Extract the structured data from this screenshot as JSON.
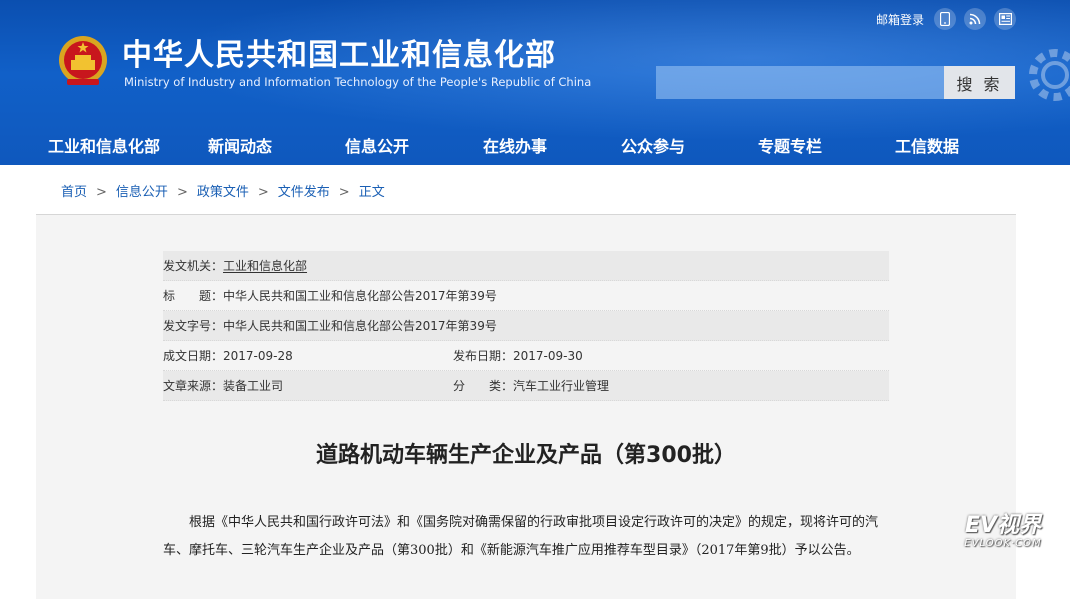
{
  "header": {
    "title_cn": "中华人民共和国工业和信息化部",
    "title_en": "Ministry of Industry and Information Technology of the People's Republic of China",
    "mail_login": "邮箱登录",
    "icons": [
      "mobile-icon",
      "rss-icon",
      "news-icon"
    ],
    "search_placeholder": "",
    "search_button": "搜 索"
  },
  "nav": {
    "items": [
      "工业和信息化部",
      "新闻动态",
      "信息公开",
      "在线办事",
      "公众参与",
      "专题专栏",
      "工信数据"
    ]
  },
  "breadcrumb": [
    "首页",
    "信息公开",
    "政策文件",
    "文件发布",
    "正文"
  ],
  "breadcrumb_separator": ">",
  "meta": {
    "issuer_label": "发文机关：",
    "issuer_value": "工业和信息化部",
    "title_label": "标　　题：",
    "title_value": "中华人民共和国工业和信息化部公告2017年第39号",
    "docno_label": "发文字号：",
    "docno_value": "中华人民共和国工业和信息化部公告2017年第39号",
    "created_label": "成文日期：",
    "created_value": "2017-09-28",
    "published_label": "发布日期：",
    "published_value": "2017-09-30",
    "source_label": "文章来源：",
    "source_value": "装备工业司",
    "category_label": "分　　类：",
    "category_value": "汽车工业行业管理"
  },
  "document": {
    "title": "道路机动车辆生产企业及产品（第300批）",
    "paragraph": "根据《中华人民共和国行政许可法》和《国务院对确需保留的行政审批项目设定行政许可的决定》的规定，现将许可的汽车、摩托车、三轮汽车生产企业及产品（第300批）和《新能源汽车推广应用推荐车型目录》（2017年第9批）予以公告。"
  },
  "watermark": {
    "main": "EV视界",
    "sub": "EVLOOK·COM"
  },
  "colors": {
    "header_blue": "#1160c8",
    "link_blue": "#1a5fb4",
    "panel_gray": "#f4f4f4"
  }
}
